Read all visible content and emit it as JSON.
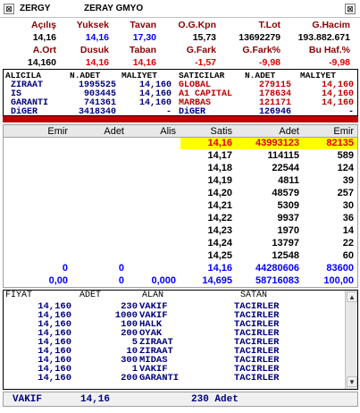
{
  "window": {
    "symbol": "ZERGY",
    "name": "ZERAY GMYO"
  },
  "summary": {
    "row1_labels": [
      "Açılış",
      "Yuksek",
      "Tavan",
      "O.G.Kpn",
      "T.Lot",
      "G.Hacim"
    ],
    "row1_values": [
      "14,16",
      "14,16",
      "17,30",
      "15,73",
      "13692279",
      "193.882.671"
    ],
    "row2_labels": [
      "A.Ort",
      "Dusuk",
      "Taban",
      "G.Fark",
      "G.Fark%",
      "Bu Haf.%"
    ],
    "row2_values": [
      "14,160",
      "14,16",
      "14,16",
      "-1,57",
      "-9,98",
      "-9,98"
    ]
  },
  "broker": {
    "headers": [
      "ALICILA",
      "N.ADET",
      "MALIYET",
      "SATICILAR",
      "N.ADET",
      "MALIYET"
    ],
    "rows": [
      {
        "buyer": "ZIRAAT",
        "buy_qty": "1995525",
        "buy_cost": "14,160",
        "seller": "GLOBAL",
        "sell_qty": "279115",
        "sell_cost": "14,160"
      },
      {
        "buyer": "IS",
        "buy_qty": "903445",
        "buy_cost": "14,160",
        "seller": "A1 CAPITAL",
        "sell_qty": "178634",
        "sell_cost": "14,160"
      },
      {
        "buyer": "GARANTI",
        "buy_qty": "741361",
        "buy_cost": "14,160",
        "seller": "MARBAS",
        "sell_qty": "121171",
        "sell_cost": "14,160"
      },
      {
        "buyer": "DiGER",
        "buy_qty": "3418340",
        "buy_cost": "-",
        "seller": "DiGER",
        "sell_qty": "126946",
        "sell_cost": "-"
      }
    ]
  },
  "depth": {
    "headers": [
      "Emir",
      "Adet",
      "Alis",
      "Satis",
      "Adet",
      "Emir"
    ],
    "rows": [
      {
        "price": "14,16",
        "qty": "43993123",
        "orders": "82135"
      },
      {
        "price": "14,17",
        "qty": "114115",
        "orders": "589"
      },
      {
        "price": "14,18",
        "qty": "22544",
        "orders": "124"
      },
      {
        "price": "14,19",
        "qty": "4811",
        "orders": "39"
      },
      {
        "price": "14,20",
        "qty": "48579",
        "orders": "257"
      },
      {
        "price": "14,21",
        "qty": "5309",
        "orders": "30"
      },
      {
        "price": "14,22",
        "qty": "9937",
        "orders": "36"
      },
      {
        "price": "14,23",
        "qty": "1970",
        "orders": "14"
      },
      {
        "price": "14,24",
        "qty": "13797",
        "orders": "22"
      },
      {
        "price": "14,25",
        "qty": "12548",
        "orders": "60"
      }
    ],
    "total1": {
      "emir": "0",
      "adet": "0",
      "satis": "14,16",
      "adet_s": "44280606",
      "emir_s": "83600"
    },
    "total2": {
      "emir": "0,00",
      "adet": "0",
      "alis": "0,000",
      "satis": "14,695",
      "adet_s": "58716083",
      "emir_s": "100,00"
    }
  },
  "trades": {
    "headers": [
      "FIYAT",
      "ADET",
      "ALAN",
      "SATAN"
    ],
    "rows": [
      {
        "price": "14,160",
        "qty": "230",
        "buyer": "VAKIF",
        "seller": "TACIRLER"
      },
      {
        "price": "14,160",
        "qty": "1000",
        "buyer": "VAKIF",
        "seller": "TACIRLER"
      },
      {
        "price": "14,160",
        "qty": "100",
        "buyer": "HALK",
        "seller": "TACIRLER"
      },
      {
        "price": "14,160",
        "qty": "200",
        "buyer": "OYAK",
        "seller": "TACIRLER"
      },
      {
        "price": "14,160",
        "qty": "5",
        "buyer": "ZIRAAT",
        "seller": "TACIRLER"
      },
      {
        "price": "14,160",
        "qty": "10",
        "buyer": "ZIRAAT",
        "seller": "TACIRLER"
      },
      {
        "price": "14,160",
        "qty": "300",
        "buyer": "MIDAS",
        "seller": "TACIRLER"
      },
      {
        "price": "14,160",
        "qty": "1",
        "buyer": "VAKIF",
        "seller": "TACIRLER"
      },
      {
        "price": "14,160",
        "qty": "200",
        "buyer": "GARANTI",
        "seller": "TACIRLER"
      }
    ]
  },
  "status": {
    "broker": "VAKIF",
    "price": "14,16",
    "qty": "230 Adet"
  },
  "colors": {
    "label": "#8b0000",
    "up": "#0000ff",
    "down": "#e00000",
    "highlight": "#ffff00",
    "bar": "#c00000"
  },
  "icons": {
    "window": "window-icon",
    "close": "close-icon",
    "scroll_up": "scroll-up-icon",
    "scroll_down": "scroll-down-icon"
  }
}
